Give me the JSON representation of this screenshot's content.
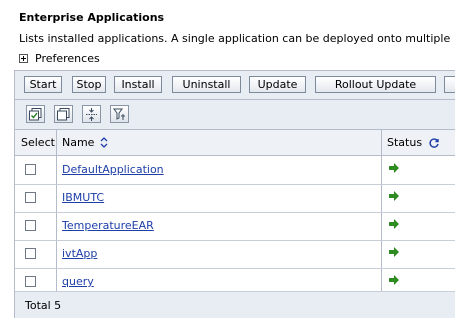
{
  "page": {
    "title": "Enterprise Applications",
    "description": "Lists installed applications. A single application can be deployed onto multiple",
    "preferences_label": "Preferences"
  },
  "toolbar": {
    "buttons": [
      "Start",
      "Stop",
      "Install",
      "Uninstall",
      "Update",
      "Rollout Update"
    ]
  },
  "icons": [
    "select-all-icon",
    "deselect-all-icon",
    "collapse-rows-icon",
    "filter-icon"
  ],
  "table": {
    "headers": {
      "select": "Select",
      "name": "Name",
      "status": "Status"
    },
    "rows": [
      {
        "name": "DefaultApplication",
        "status": "started"
      },
      {
        "name": "IBMUTC",
        "status": "started"
      },
      {
        "name": "TemperatureEAR",
        "status": "started"
      },
      {
        "name": "ivtApp",
        "status": "started"
      },
      {
        "name": "query",
        "status": "started"
      }
    ],
    "total": "Total 5"
  },
  "colors": {
    "link": "#1f3fa8",
    "status_arrow": "#2e8b22",
    "bar": "#e8edf3"
  }
}
